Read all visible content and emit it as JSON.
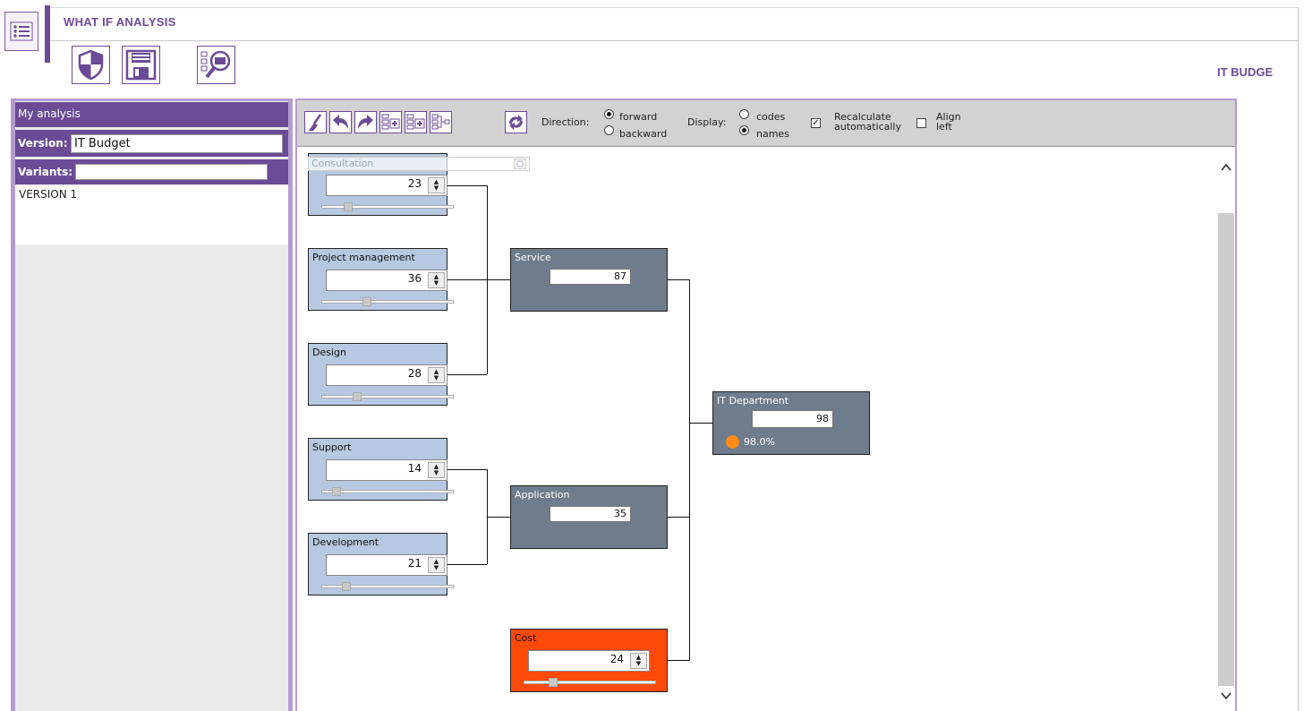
{
  "header": {
    "app_title": "WHAT IF ANALYSIS",
    "context_label": "IT BUDGE",
    "icons": [
      "menu-icon",
      "shield-icon",
      "save-icon",
      "explorer-icon"
    ]
  },
  "left_panel": {
    "analysis_label": "My analysis",
    "version_label": "Version:",
    "version_value": "IT Budget",
    "variants_label": "Variants:",
    "variants_value": "",
    "versions": [
      "VERSION 1"
    ]
  },
  "toolbar": {
    "tools": [
      "broom-icon",
      "undo-icon",
      "redo-icon",
      "expand-tree-icon",
      "collapse-tree-icon",
      "tree-structure-icon",
      "refresh-icon"
    ],
    "direction_label": "Direction:",
    "direction_forward": "forward",
    "direction_backward": "backward",
    "direction_selected": "forward",
    "display_label": "Display:",
    "display_codes": "codes",
    "display_names": "names",
    "display_selected": "names",
    "recalc_label_1": "Recalculate",
    "recalc_label_2": "automatically",
    "recalc_checked": true,
    "align_label_1": "Align",
    "align_label_2": "left",
    "align_checked": false
  },
  "search": {
    "placeholder": "Consultation"
  },
  "nodes": {
    "consultation": {
      "title": "Consultation",
      "value": "23",
      "slider": 0.2
    },
    "project_management": {
      "title": "Project management",
      "value": "36",
      "slider": 0.33
    },
    "design": {
      "title": "Design",
      "value": "28",
      "slider": 0.25
    },
    "support": {
      "title": "Support",
      "value": "14",
      "slider": 0.1
    },
    "development": {
      "title": "Development",
      "value": "21",
      "slider": 0.19
    },
    "service": {
      "title": "Service",
      "value": "87"
    },
    "application": {
      "title": "Application",
      "value": "35"
    },
    "it_department": {
      "title": "IT Department",
      "value": "98",
      "percent": "98.0%",
      "status_color": "#ff8c1a"
    },
    "cost": {
      "title": "Cost",
      "value": "24",
      "slider": 0.22
    }
  },
  "colors": {
    "brand": "#6b4b96",
    "leaf_node": "#b7c9e2",
    "aggregate_node": "#6e7c8c",
    "cost_node": "#ff4a0a"
  }
}
